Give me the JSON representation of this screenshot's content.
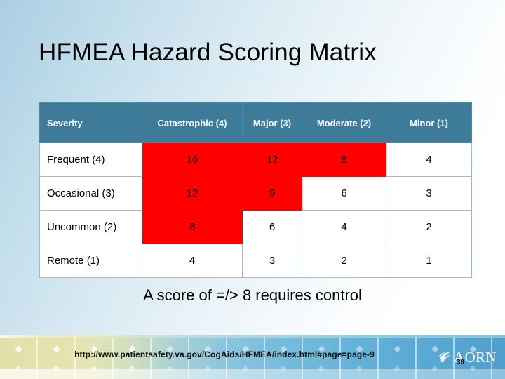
{
  "slide": {
    "title": "HFMEA Hazard Scoring Matrix",
    "caption": "A score of =/> 8 requires control",
    "number": "39"
  },
  "matrix": {
    "corner_header": "Severity",
    "column_headers": [
      "Catastrophic (4)",
      "Major (3)",
      "Moderate (2)",
      "Minor (1)"
    ],
    "rows": [
      {
        "label": "Frequent (4)",
        "scores": [
          "16",
          "12",
          "8",
          "4"
        ],
        "highlight": [
          true,
          true,
          true,
          false
        ]
      },
      {
        "label": "Occasional (3)",
        "scores": [
          "12",
          "9",
          "6",
          "3"
        ],
        "highlight": [
          true,
          true,
          false,
          false
        ]
      },
      {
        "label": "Uncommon (2)",
        "scores": [
          "8",
          "6",
          "4",
          "2"
        ],
        "highlight": [
          true,
          false,
          false,
          false
        ]
      },
      {
        "label": "Remote (1)",
        "scores": [
          "4",
          "3",
          "2",
          "1"
        ],
        "highlight": [
          false,
          false,
          false,
          false
        ]
      }
    ]
  },
  "footer": {
    "url": "http://www.patientsafety.va.gov/CogAids/HFMEA/index.html#page=page-9",
    "logo_text": "AORN"
  },
  "colors": {
    "header_blue": "#3d7b99",
    "highlight_red": "#fe0000",
    "cell_border": "#9cbccd",
    "band_start": "#e2dfa8",
    "band_end": "#4f9fcb"
  }
}
